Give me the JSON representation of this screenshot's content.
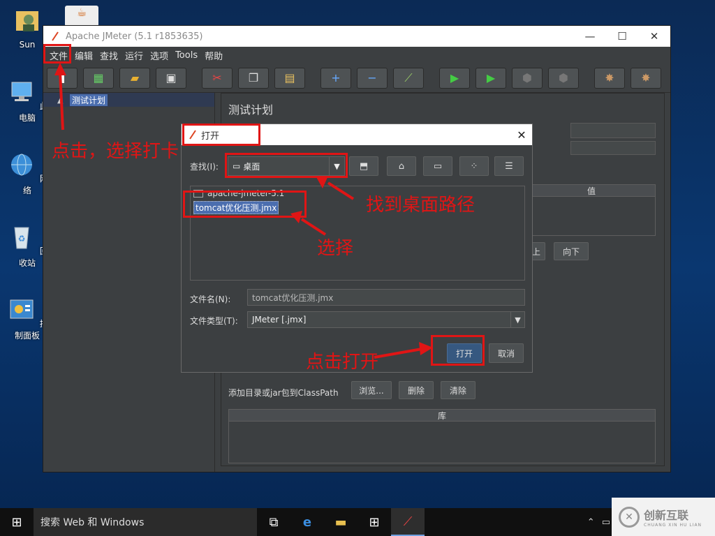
{
  "desktop": {
    "icons": [
      {
        "label": "Sun"
      },
      {
        "label": "此电脑"
      },
      {
        "label": "网络"
      },
      {
        "label": "回收站"
      },
      {
        "label": "控制面板"
      }
    ]
  },
  "window": {
    "title": "Apache JMeter (5.1 r1853635)",
    "controls": {
      "minimize": "—",
      "maximize": "☐",
      "close": "✕"
    },
    "menu": [
      "文件",
      "编辑",
      "查找",
      "运行",
      "选项",
      "Tools",
      "帮助"
    ],
    "toolbar_icons": [
      "new-icon",
      "templates-icon",
      "open-icon",
      "save-icon",
      "cut-icon",
      "copy-icon",
      "paste-icon",
      "expand-icon",
      "collapse-icon",
      "toggle-icon",
      "start-icon",
      "start-no-pause-icon",
      "stop-icon",
      "shutdown-icon",
      "clear-icon",
      "clear-all-icon"
    ],
    "tree": {
      "root_label": "测试计划"
    },
    "right": {
      "title": "测试计划",
      "table_header": "值",
      "down_button": "向下",
      "partial_button": "上",
      "classpath_label": "添加目录或jar包到ClassPath",
      "browse_button": "浏览...",
      "delete_button": "删除",
      "clear_button": "清除",
      "lib_header": "库"
    }
  },
  "dialog": {
    "title": "打开",
    "close": "✕",
    "look_in_label": "查找(I):",
    "look_in_value": "桌面",
    "files": [
      {
        "name": "apache-jmeter-5.1",
        "selected": false
      },
      {
        "name": "tomcat优化压测.jmx",
        "selected": true
      }
    ],
    "filename_label": "文件名(N):",
    "filename_value": "tomcat优化压测.jmx",
    "filetype_label": "文件类型(T):",
    "filetype_value": "JMeter [.jmx]",
    "open_button": "打开",
    "cancel_button": "取消"
  },
  "annotations": {
    "click_select": "点击，选择打卡",
    "find_desktop": "找到桌面路径",
    "select": "选择",
    "click_open": "点击打开",
    "color": "#e01515"
  },
  "taskbar": {
    "search_placeholder": "搜索 Web 和 Windows"
  },
  "watermark": {
    "cn": "创新互联",
    "en": "CHUANG XIN HU LIAN"
  }
}
